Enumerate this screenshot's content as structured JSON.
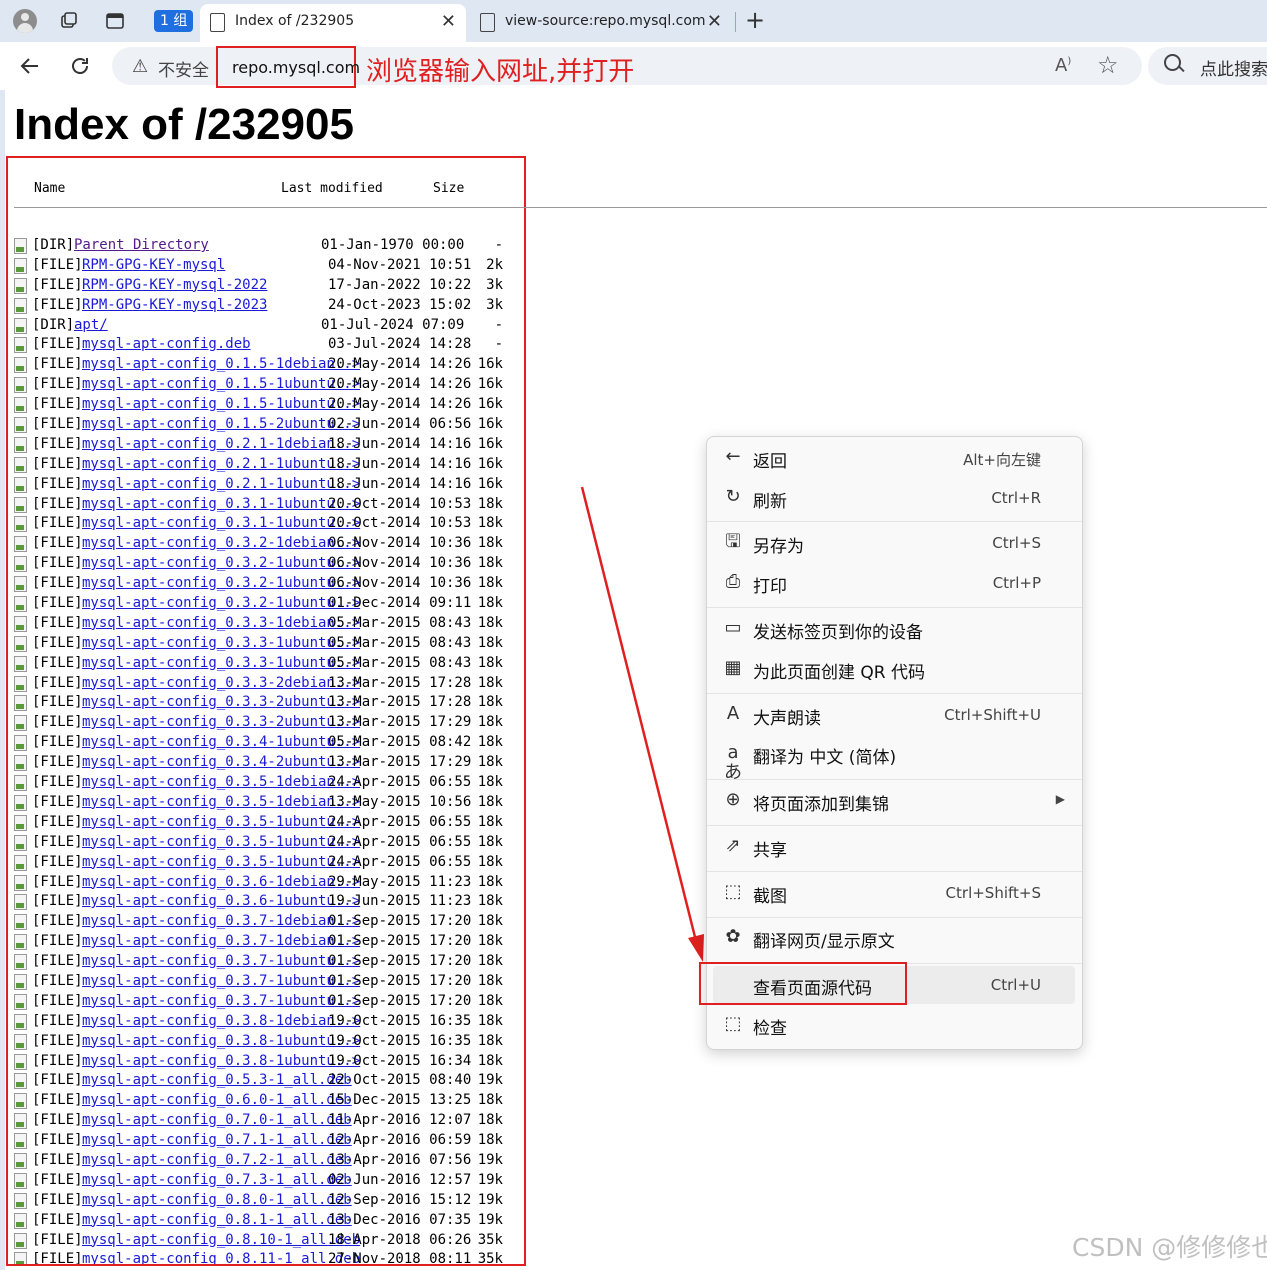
{
  "browser": {
    "tab_group": "1 组",
    "tabs": [
      {
        "title": "Index of /232905",
        "close": "✕"
      },
      {
        "title": "view-source:repo.mysql.com",
        "close": "✕"
      }
    ],
    "new_tab": "+",
    "security": "不安全",
    "url": "repo.mysql.com",
    "annotation": "浏览器输入网址,并打开",
    "search_placeholder": "点此搜索"
  },
  "page": {
    "title": "Index of /232905",
    "headers": {
      "name": "Name",
      "modified": "Last modified",
      "size": "Size"
    },
    "rows": [
      {
        "type": "[DIR]",
        "name": "Parent Directory",
        "date": "01-Jan-1970 00:00",
        "size": "-",
        "parent": true
      },
      {
        "type": "[FILE]",
        "name": "RPM-GPG-KEY-mysql",
        "date": "04-Nov-2021 10:51",
        "size": "2k"
      },
      {
        "type": "[FILE]",
        "name": "RPM-GPG-KEY-mysql-2022",
        "date": "17-Jan-2022 10:22",
        "size": "3k"
      },
      {
        "type": "[FILE]",
        "name": "RPM-GPG-KEY-mysql-2023",
        "date": "24-Oct-2023 15:02",
        "size": "3k"
      },
      {
        "type": "[DIR]",
        "name": "apt/",
        "date": "01-Jul-2024 07:09",
        "size": "-"
      },
      {
        "type": "[FILE]",
        "name": "mysql-apt-config.deb",
        "date": "03-Jul-2024 14:28",
        "size": "-"
      },
      {
        "type": "[FILE]",
        "name": "mysql-apt-config_0.1.5-1debian..>",
        "date": "20-May-2014 14:26",
        "size": "16k"
      },
      {
        "type": "[FILE]",
        "name": "mysql-apt-config_0.1.5-1ubuntu..>",
        "date": "20-May-2014 14:26",
        "size": "16k"
      },
      {
        "type": "[FILE]",
        "name": "mysql-apt-config_0.1.5-1ubuntu..>",
        "date": "20-May-2014 14:26",
        "size": "16k"
      },
      {
        "type": "[FILE]",
        "name": "mysql-apt-config_0.1.5-2ubuntu..>",
        "date": "02-Jun-2014 06:56",
        "size": "16k"
      },
      {
        "type": "[FILE]",
        "name": "mysql-apt-config_0.2.1-1debian..>",
        "date": "18-Jun-2014 14:16",
        "size": "16k"
      },
      {
        "type": "[FILE]",
        "name": "mysql-apt-config_0.2.1-1ubuntu..>",
        "date": "18-Jun-2014 14:16",
        "size": "16k"
      },
      {
        "type": "[FILE]",
        "name": "mysql-apt-config_0.2.1-1ubuntu..>",
        "date": "18-Jun-2014 14:16",
        "size": "16k"
      },
      {
        "type": "[FILE]",
        "name": "mysql-apt-config_0.3.1-1ubuntu..>",
        "date": "20-Oct-2014 10:53",
        "size": "18k"
      },
      {
        "type": "[FILE]",
        "name": "mysql-apt-config_0.3.1-1ubuntu..>",
        "date": "20-Oct-2014 10:53",
        "size": "18k"
      },
      {
        "type": "[FILE]",
        "name": "mysql-apt-config_0.3.2-1debian..>",
        "date": "06-Nov-2014 10:36",
        "size": "18k"
      },
      {
        "type": "[FILE]",
        "name": "mysql-apt-config_0.3.2-1ubuntu..>",
        "date": "06-Nov-2014 10:36",
        "size": "18k"
      },
      {
        "type": "[FILE]",
        "name": "mysql-apt-config_0.3.2-1ubuntu..>",
        "date": "06-Nov-2014 10:36",
        "size": "18k"
      },
      {
        "type": "[FILE]",
        "name": "mysql-apt-config_0.3.2-1ubuntu..>",
        "date": "01-Dec-2014 09:11",
        "size": "18k"
      },
      {
        "type": "[FILE]",
        "name": "mysql-apt-config_0.3.3-1debian..>",
        "date": "05-Mar-2015 08:43",
        "size": "18k"
      },
      {
        "type": "[FILE]",
        "name": "mysql-apt-config_0.3.3-1ubuntu..>",
        "date": "05-Mar-2015 08:43",
        "size": "18k"
      },
      {
        "type": "[FILE]",
        "name": "mysql-apt-config_0.3.3-1ubuntu..>",
        "date": "05-Mar-2015 08:43",
        "size": "18k"
      },
      {
        "type": "[FILE]",
        "name": "mysql-apt-config_0.3.3-2debian..>",
        "date": "13-Mar-2015 17:28",
        "size": "18k"
      },
      {
        "type": "[FILE]",
        "name": "mysql-apt-config_0.3.3-2ubuntu..>",
        "date": "13-Mar-2015 17:28",
        "size": "18k"
      },
      {
        "type": "[FILE]",
        "name": "mysql-apt-config_0.3.3-2ubuntu..>",
        "date": "13-Mar-2015 17:29",
        "size": "18k"
      },
      {
        "type": "[FILE]",
        "name": "mysql-apt-config_0.3.4-1ubuntu..>",
        "date": "05-Mar-2015 08:42",
        "size": "18k"
      },
      {
        "type": "[FILE]",
        "name": "mysql-apt-config_0.3.4-2ubuntu..>",
        "date": "13-Mar-2015 17:29",
        "size": "18k"
      },
      {
        "type": "[FILE]",
        "name": "mysql-apt-config_0.3.5-1debian..>",
        "date": "24-Apr-2015 06:55",
        "size": "18k"
      },
      {
        "type": "[FILE]",
        "name": "mysql-apt-config_0.3.5-1debian..>",
        "date": "13-May-2015 10:56",
        "size": "18k"
      },
      {
        "type": "[FILE]",
        "name": "mysql-apt-config_0.3.5-1ubuntu..>",
        "date": "24-Apr-2015 06:55",
        "size": "18k"
      },
      {
        "type": "[FILE]",
        "name": "mysql-apt-config_0.3.5-1ubuntu..>",
        "date": "24-Apr-2015 06:55",
        "size": "18k"
      },
      {
        "type": "[FILE]",
        "name": "mysql-apt-config_0.3.5-1ubuntu..>",
        "date": "24-Apr-2015 06:55",
        "size": "18k"
      },
      {
        "type": "[FILE]",
        "name": "mysql-apt-config_0.3.6-1debian..>",
        "date": "29-May-2015 11:23",
        "size": "18k"
      },
      {
        "type": "[FILE]",
        "name": "mysql-apt-config_0.3.6-1ubuntu..>",
        "date": "19-Jun-2015 11:23",
        "size": "18k"
      },
      {
        "type": "[FILE]",
        "name": "mysql-apt-config_0.3.7-1debian..>",
        "date": "01-Sep-2015 17:20",
        "size": "18k"
      },
      {
        "type": "[FILE]",
        "name": "mysql-apt-config_0.3.7-1debian..>",
        "date": "01-Sep-2015 17:20",
        "size": "18k"
      },
      {
        "type": "[FILE]",
        "name": "mysql-apt-config_0.3.7-1ubuntu..>",
        "date": "01-Sep-2015 17:20",
        "size": "18k"
      },
      {
        "type": "[FILE]",
        "name": "mysql-apt-config_0.3.7-1ubuntu..>",
        "date": "01-Sep-2015 17:20",
        "size": "18k"
      },
      {
        "type": "[FILE]",
        "name": "mysql-apt-config_0.3.7-1ubuntu..>",
        "date": "01-Sep-2015 17:20",
        "size": "18k"
      },
      {
        "type": "[FILE]",
        "name": "mysql-apt-config_0.3.8-1debian..>",
        "date": "19-Oct-2015 16:35",
        "size": "18k"
      },
      {
        "type": "[FILE]",
        "name": "mysql-apt-config_0.3.8-1ubuntu..>",
        "date": "19-Oct-2015 16:35",
        "size": "18k"
      },
      {
        "type": "[FILE]",
        "name": "mysql-apt-config_0.3.8-1ubuntu..>",
        "date": "19-Oct-2015 16:34",
        "size": "18k"
      },
      {
        "type": "[FILE]",
        "name": "mysql-apt-config_0.5.3-1_all.deb",
        "date": "22-Oct-2015 08:40",
        "size": "19k"
      },
      {
        "type": "[FILE]",
        "name": "mysql-apt-config_0.6.0-1_all.deb",
        "date": "15-Dec-2015 13:25",
        "size": "18k"
      },
      {
        "type": "[FILE]",
        "name": "mysql-apt-config_0.7.0-1_all.deb",
        "date": "11-Apr-2016 12:07",
        "size": "18k"
      },
      {
        "type": "[FILE]",
        "name": "mysql-apt-config_0.7.1-1_all.deb",
        "date": "12-Apr-2016 06:59",
        "size": "18k"
      },
      {
        "type": "[FILE]",
        "name": "mysql-apt-config_0.7.2-1_all.deb",
        "date": "13-Apr-2016 07:56",
        "size": "19k"
      },
      {
        "type": "[FILE]",
        "name": "mysql-apt-config_0.7.3-1_all.deb",
        "date": "02-Jun-2016 12:57",
        "size": "19k"
      },
      {
        "type": "[FILE]",
        "name": "mysql-apt-config_0.8.0-1_all.deb",
        "date": "12-Sep-2016 15:12",
        "size": "19k"
      },
      {
        "type": "[FILE]",
        "name": "mysql-apt-config_0.8.1-1_all.deb",
        "date": "13-Dec-2016 07:35",
        "size": "19k"
      },
      {
        "type": "[FILE]",
        "name": "mysql-apt-config_0.8.10-1_all.deb",
        "date": "18-Apr-2018 06:26",
        "size": "35k"
      },
      {
        "type": "[FILE]",
        "name": "mysql-apt-config_0.8.11-1_all.deb",
        "date": "27-Nov-2018 08:11",
        "size": "35k"
      }
    ]
  },
  "context_menu": {
    "items": [
      {
        "icon": "back-icon",
        "glyph": "←",
        "label": "返回",
        "shortcut": "Alt+向左键"
      },
      {
        "icon": "refresh-icon",
        "glyph": "↻",
        "label": "刷新",
        "shortcut": "Ctrl+R"
      },
      {
        "icon": "save-icon",
        "glyph": "🖫",
        "label": "另存为",
        "shortcut": "Ctrl+S"
      },
      {
        "icon": "print-icon",
        "glyph": "⎙",
        "label": "打印",
        "shortcut": "Ctrl+P"
      },
      {
        "icon": "send-device-icon",
        "glyph": "▭",
        "label": "发送标签页到你的设备",
        "shortcut": ""
      },
      {
        "icon": "qr-code-icon",
        "glyph": "▦",
        "label": "为此页面创建 QR 代码",
        "shortcut": ""
      },
      {
        "icon": "read-aloud-icon",
        "glyph": "A",
        "label": "大声朗读",
        "shortcut": "Ctrl+Shift+U"
      },
      {
        "icon": "translate-icon",
        "glyph": "aあ",
        "label": "翻译为 中文 (简体)",
        "shortcut": ""
      },
      {
        "icon": "collections-icon",
        "glyph": "⊕",
        "label": "将页面添加到集锦",
        "shortcut": "",
        "submenu": true
      },
      {
        "icon": "share-icon",
        "glyph": "⇗",
        "label": "共享",
        "shortcut": ""
      },
      {
        "icon": "screenshot-icon",
        "glyph": "⬚",
        "label": "截图",
        "shortcut": "Ctrl+Shift+S"
      },
      {
        "icon": "translate-page-icon",
        "glyph": "✿",
        "label": "翻译网页/显示原文",
        "shortcut": ""
      },
      {
        "icon": "view-source-icon",
        "glyph": "",
        "label": "查看页面源代码",
        "shortcut": "Ctrl+U"
      },
      {
        "icon": "inspect-icon",
        "glyph": "⬚",
        "label": "检查",
        "shortcut": ""
      }
    ]
  },
  "watermark": "CSDN @修修修也",
  "colors": {
    "annotation": "#e02020",
    "link": "#1a1ad6",
    "visited": "#551a8b",
    "accent": "#1f6fe0"
  }
}
